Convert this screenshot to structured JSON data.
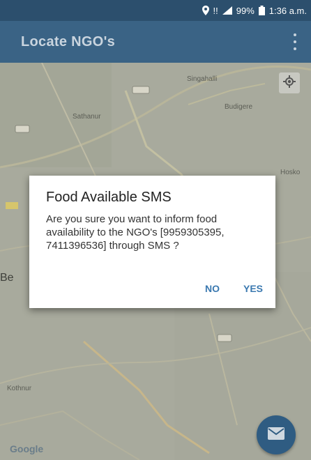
{
  "status": {
    "signal_text": "!!",
    "battery": "99%",
    "time": "1:36 a.m."
  },
  "appbar": {
    "title": "Locate NGO's"
  },
  "map": {
    "labels": {
      "singahalli": "Singahalli",
      "budigere": "Budigere",
      "sathanur": "Sathanur",
      "hosko": "Hosko",
      "be": "Be",
      "kothnur": "Kothnur"
    },
    "google_logo": "Google"
  },
  "dialog": {
    "title": "Food Available SMS",
    "message": "Are you sure you want to inform food availability to the NGO's [9959305395, 7411396536] through SMS ?",
    "no_label": "NO",
    "yes_label": "YES"
  },
  "colors": {
    "appbar": "#3a6385",
    "statusbar": "#2c4f6d",
    "accent": "#3b79b0",
    "fab": "#2f5c82"
  },
  "icons": {
    "location": "location-pin-icon",
    "signal": "signal-icon",
    "battery": "battery-icon",
    "menu": "overflow-menu-icon",
    "my_location": "my-location-icon",
    "fab": "mail-icon"
  }
}
